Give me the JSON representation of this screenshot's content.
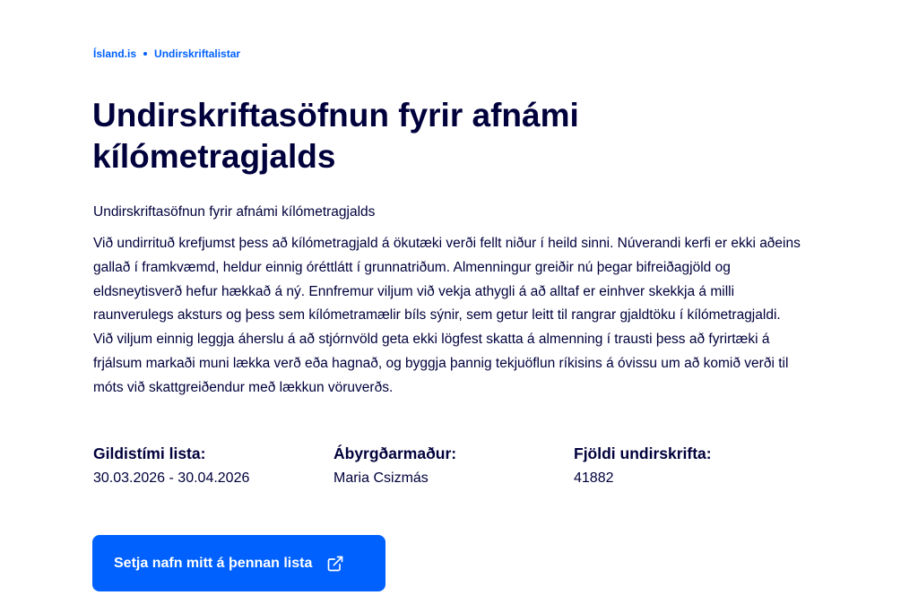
{
  "breadcrumb": {
    "items": [
      "Ísland.is",
      "Undirskriftalistar"
    ]
  },
  "title": "Undirskriftasöfnun fyrir afnámi kílómetragjalds",
  "subtitle": "Undirskriftasöfnun fyrir afnámi kílómetragjalds",
  "description": "Við undirrituð krefjumst þess að kílómetragjald á ökutæki verði fellt niður í heild sinni. Núverandi kerfi er ekki aðeins gallað í framkvæmd, heldur einnig óréttlátt í grunnatriðum. Almenningur greiðir nú þegar bifreiðagjöld og eldsneytisverð hefur hækkað á ný. Ennfremur viljum við vekja athygli á að alltaf er einhver skekkja á milli raunverulegs aksturs og þess sem kílómetramælir bíls sýnir, sem getur leitt til rangrar gjaldtöku í kílómetragjaldi. Við viljum einnig leggja áherslu á að stjórnvöld geta ekki lögfest skatta á almenning í trausti þess að fyrirtæki á frjálsum markaði muni lækka verð eða hagnað, og byggja þannig tekjuöflun ríkisins á óvissu um að komið verði til móts við skattgreiðendur með lækkun vöruverðs.",
  "info": {
    "validity": {
      "label": "Gildistími lista:",
      "value": "30.03.2026 - 30.04.2026"
    },
    "owner": {
      "label": "Ábyrgðarmaður:",
      "value": "Maria Csizmás"
    },
    "count": {
      "label": "Fjöldi undirskrifta:",
      "value": "41882"
    }
  },
  "button": {
    "label": "Setja nafn mitt á þennan lista",
    "icon": "external-link-icon"
  },
  "colors": {
    "primary": "#0061ff",
    "text": "#00003c",
    "background": "#ffffff"
  }
}
